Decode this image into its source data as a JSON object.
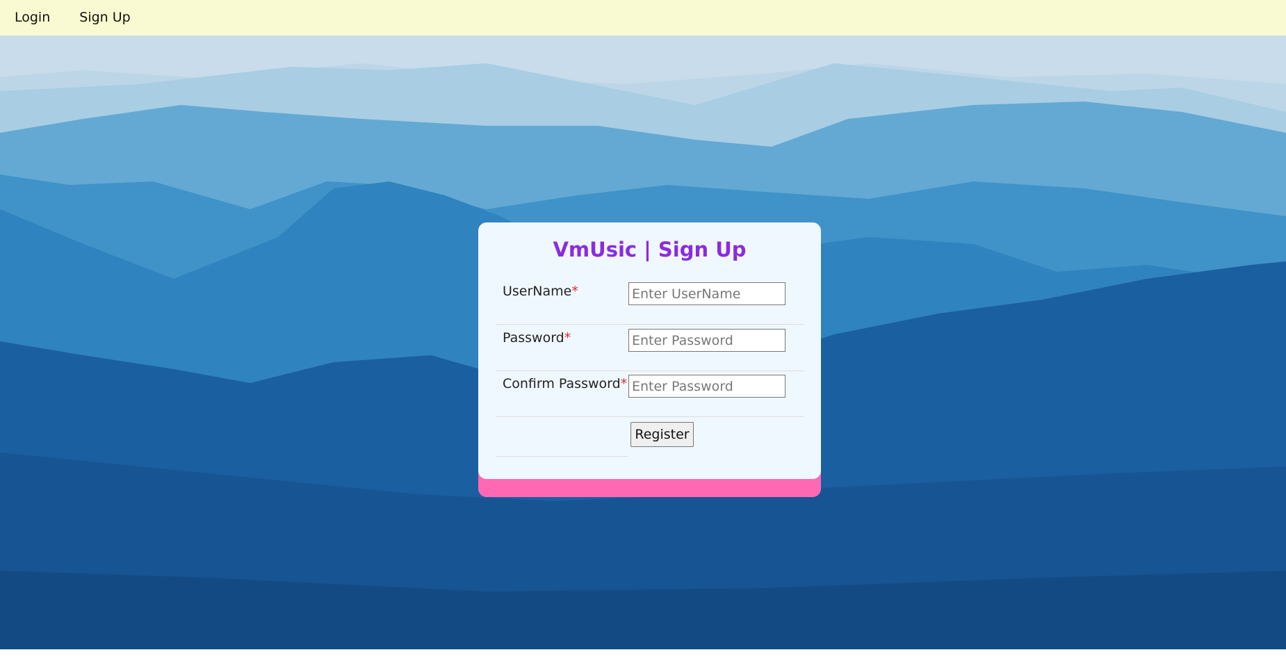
{
  "nav": {
    "items": [
      {
        "label": "Login"
      },
      {
        "label": "Sign Up"
      }
    ]
  },
  "form": {
    "title": "VmUsic | Sign Up",
    "required_marker": "*",
    "fields": [
      {
        "label": "UserName",
        "placeholder": "Enter UserName",
        "value": ""
      },
      {
        "label": "Password",
        "placeholder": "Enter Password",
        "value": ""
      },
      {
        "label": "Confirm Password",
        "placeholder": "Enter Password",
        "value": ""
      }
    ],
    "submit_label": "Register"
  },
  "colors": {
    "navbar_bg": "#fafad2",
    "title": "#8a2be2",
    "card_bg": "#f0f8ff",
    "card_accent": "#ff69b4",
    "required": "#e0282e"
  },
  "background": {
    "icon": "misty-mountains-image"
  }
}
